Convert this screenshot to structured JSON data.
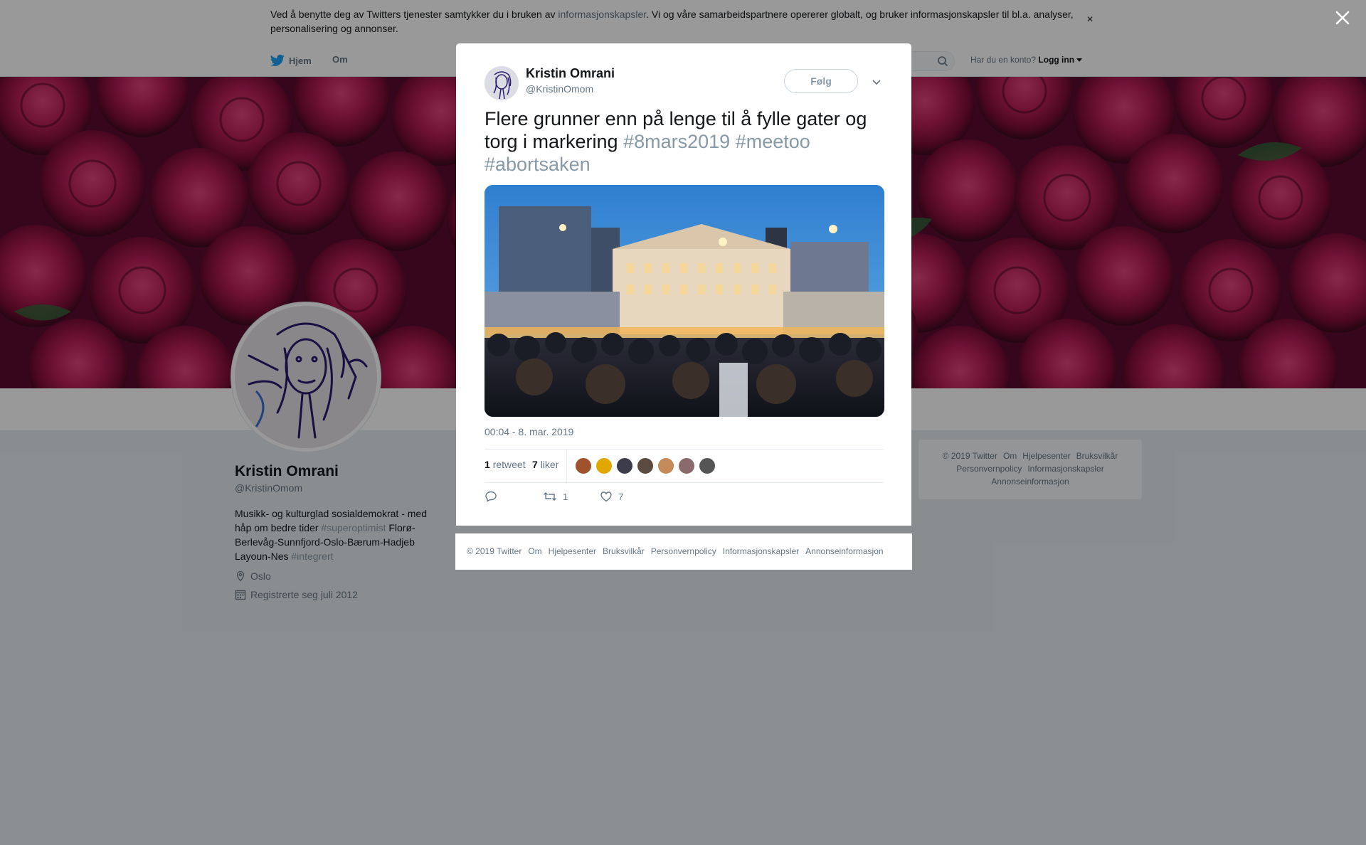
{
  "cookie": {
    "text_before": "Ved å benytte deg av Twitters tjenester samtykker du i bruken av ",
    "link": "informasjonskapsler",
    "text_after": ". Vi og våre samarbeidspartnere opererer globalt, og bruker informasjonskapsler til bl.a. analyser, personalisering og annonser.",
    "close": "×"
  },
  "nav": {
    "home": "Hjem",
    "about": "Om",
    "account_prompt": "Har du en konto?",
    "login": "Logg inn"
  },
  "profile": {
    "name": "Kristin Omrani",
    "handle": "@KristinOmom",
    "bio_text_1": "Musikk- og kulturglad sosialdemokrat - med håp om bedre tider ",
    "bio_tag_1": "#superoptimist",
    "bio_text_2": " Florø-Berlevåg-Sunnfjord-Oslo-Bærum-Hadjeb Layoun-Nes ",
    "bio_tag_2": "#integrert",
    "location": "Oslo",
    "joined": "Registrerte seg juli 2012"
  },
  "side_footer": {
    "line1": [
      "© 2019 Twitter",
      "Om",
      "Hjelpesenter",
      "Bruksvilkår"
    ],
    "line2": [
      "Personvernpolicy",
      "Informasjonskapsler"
    ],
    "line3": [
      "Annonseinformasjon"
    ]
  },
  "tweet": {
    "author_name": "Kristin Omrani",
    "author_handle": "@KristinOmom",
    "follow_label": "Følg",
    "text": "Flere grunner enn på lenge til å fylle gater og torg i markering ",
    "tags": [
      "#8mars2019",
      "#meetoo",
      "#abortsaken"
    ],
    "timestamp": "00:04 - 8. mar. 2019",
    "retweet_count": "1",
    "retweet_label": "retweet",
    "like_count": "7",
    "like_label": "liker",
    "liker_colors": [
      "#a0522d",
      "#e0a800",
      "#3c3c4a",
      "#5a4a40",
      "#c58a5a",
      "#8a6a6a",
      "#555555"
    ],
    "action_retweet_count": "1",
    "action_like_count": "7"
  },
  "modal_footer": [
    "© 2019 Twitter",
    "Om",
    "Hjelpesenter",
    "Bruksvilkår",
    "Personvernpolicy",
    "Informasjonskapsler",
    "Annonseinformasjon"
  ],
  "colors": {
    "accent": "#1da1f2",
    "hashtag": "#8899a6",
    "banner": "#6a0e3a"
  }
}
